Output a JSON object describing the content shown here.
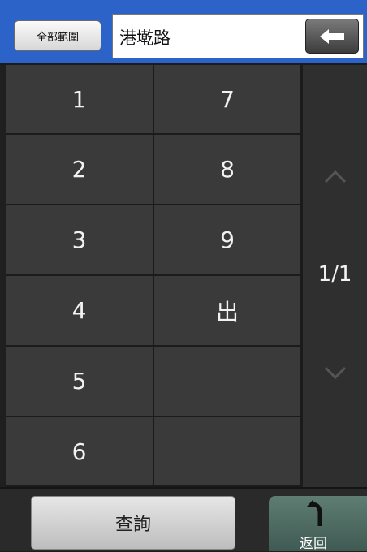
{
  "header": {
    "scope_button": "全部範圍",
    "search_value": "港墘路"
  },
  "list": {
    "col1": [
      "1",
      "2",
      "3",
      "4",
      "5",
      "6"
    ],
    "col2": [
      "7",
      "8",
      "9",
      "出",
      "",
      ""
    ]
  },
  "pager": {
    "page_text": "1/1"
  },
  "footer": {
    "query_button": "查詢",
    "return_button": "返回"
  },
  "colors": {
    "header_blue": "#2b63c9",
    "cell_bg": "#3a3a3a",
    "return_green": "#4e6b62"
  },
  "icons": {
    "backspace": "left-arrow-icon",
    "page_up": "chevron-up-icon",
    "page_down": "chevron-down-icon",
    "return": "return-arrow-icon"
  }
}
